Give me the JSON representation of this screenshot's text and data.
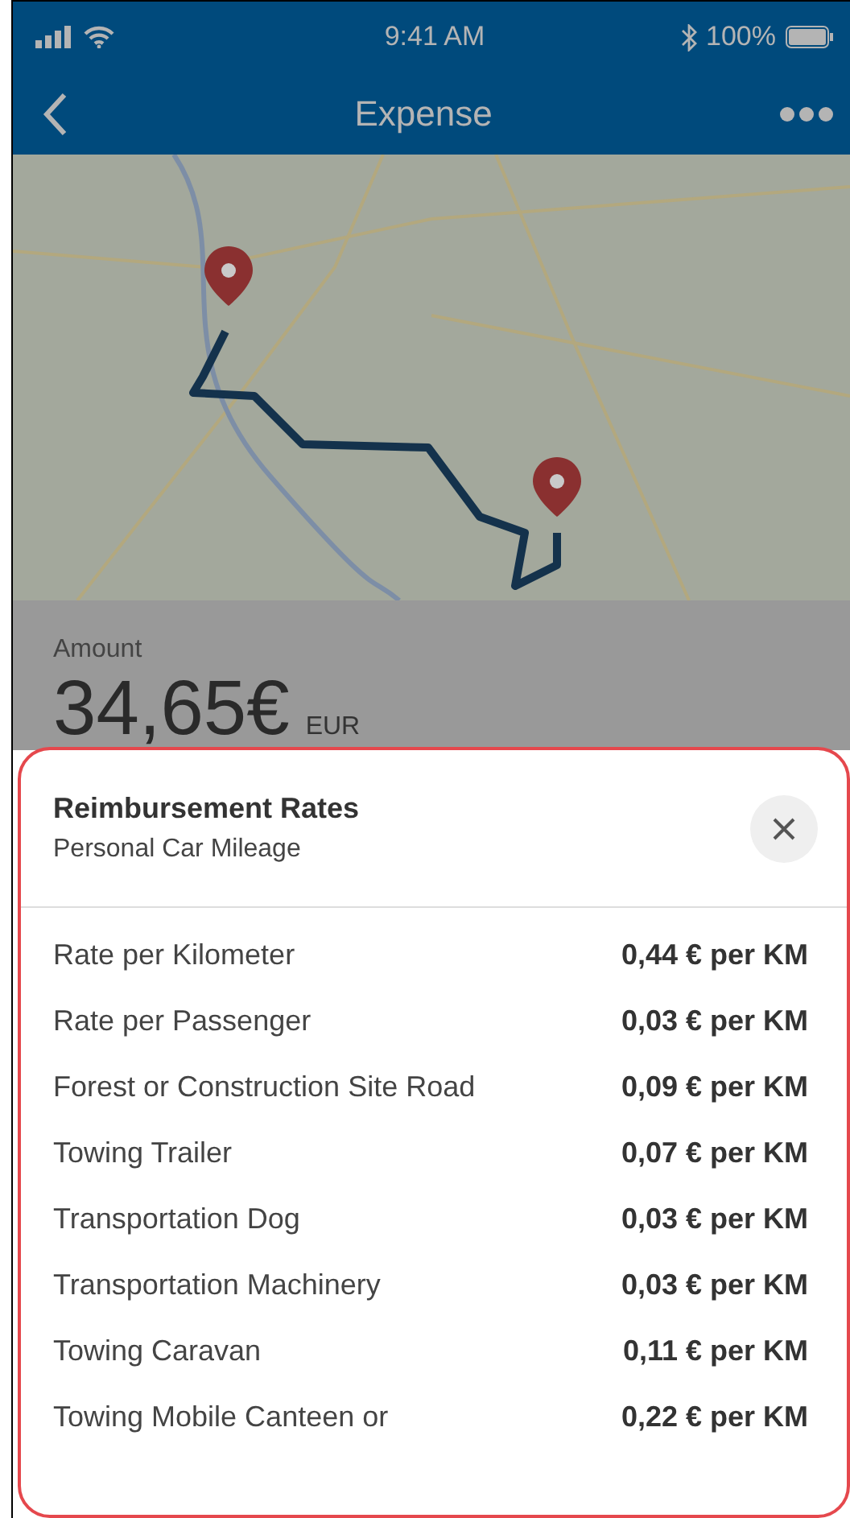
{
  "status_bar": {
    "time": "9:41 AM",
    "battery": "100%"
  },
  "nav": {
    "title": "Expense"
  },
  "amount": {
    "label": "Amount",
    "value": "34,65€",
    "currency": "EUR"
  },
  "sheet": {
    "title": "Reimbursement Rates",
    "subtitle": "Personal Car Mileage",
    "rates": [
      {
        "name": "Rate per Kilometer",
        "value": "0,44 € per KM"
      },
      {
        "name": "Rate per Passenger",
        "value": "0,03 € per KM"
      },
      {
        "name": "Forest or Construction Site Road",
        "value": "0,09 € per KM"
      },
      {
        "name": "Towing Trailer",
        "value": "0,07 € per KM"
      },
      {
        "name": "Transportation Dog",
        "value": "0,03 € per KM"
      },
      {
        "name": "Transportation Machinery",
        "value": "0,03 € per KM"
      },
      {
        "name": "Towing Caravan",
        "value": "0,11 € per KM"
      },
      {
        "name": "Towing Mobile Canteen or",
        "value": "0,22 € per KM"
      }
    ]
  }
}
